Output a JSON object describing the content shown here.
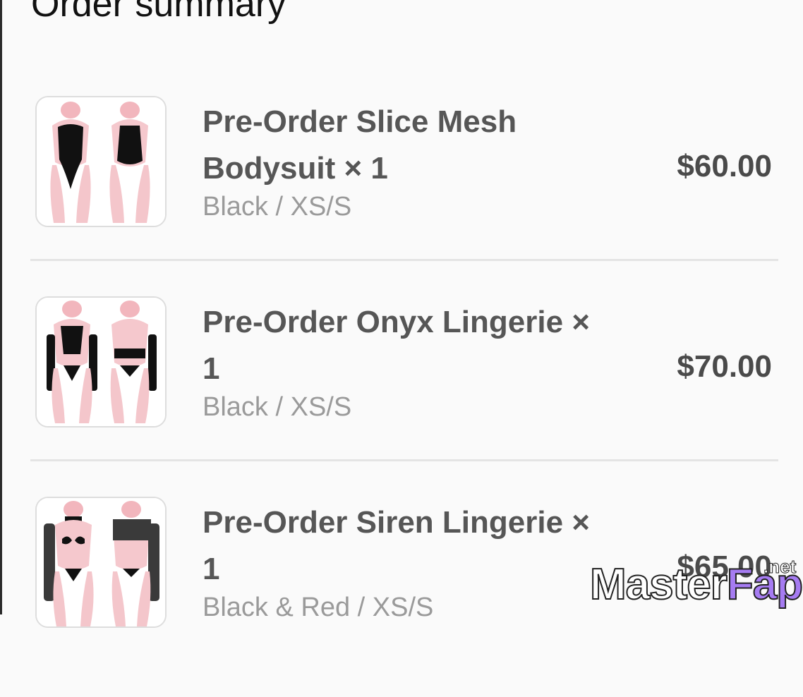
{
  "header": {
    "title": "Order summary"
  },
  "items": [
    {
      "name": "Pre-Order Slice Mesh Bodysuit × 1",
      "variant": "Black / XS/S",
      "price": "$60.00",
      "image_icon": "bodysuit-product-image"
    },
    {
      "name": "Pre-Order Onyx Lingerie × 1",
      "variant": "Black / XS/S",
      "price": "$70.00",
      "image_icon": "lingerie-product-image"
    },
    {
      "name": "Pre-Order Siren Lingerie × 1",
      "variant": "Black & Red / XS/S",
      "price": "$65.00",
      "image_icon": "lingerie-product-image"
    }
  ],
  "watermark": {
    "brand_part1": "Master",
    "brand_part2": "Fap",
    "suffix": ".net"
  },
  "colors": {
    "background": "#fafafa",
    "title": "#111111",
    "item_text": "#565656",
    "variant_text": "#9a9a9a",
    "divider": "#e4e4e4"
  }
}
